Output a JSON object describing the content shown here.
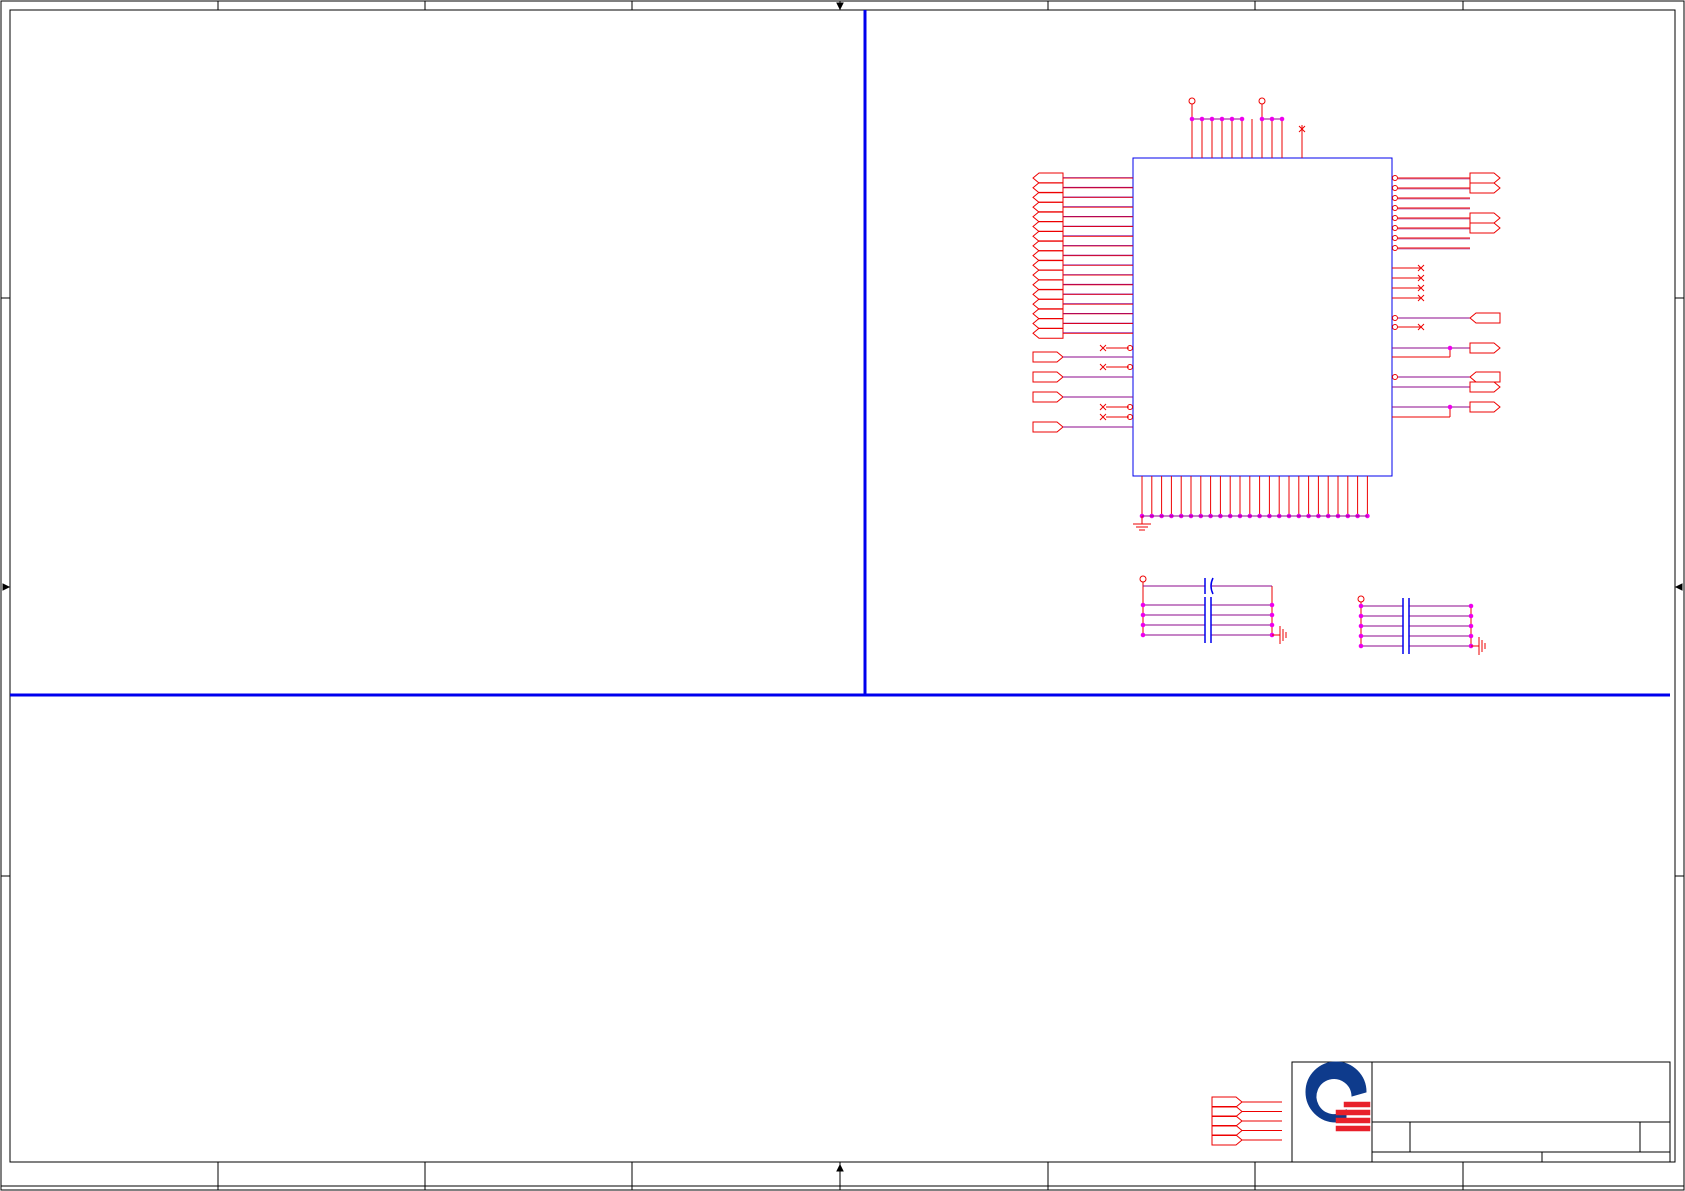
{
  "colors": {
    "frame": "#000000",
    "divider": "#0000ee",
    "chip_outline": "#0000ee",
    "wire": "#ee0000",
    "net_wire": "#8e0a8e",
    "junction": "#ee00ee",
    "logo_blue": "#0e3b8c",
    "logo_red": "#e8202a"
  },
  "diagram": {
    "top_power_pins": 12,
    "left_port_count": 17,
    "left_input_ports": 4,
    "right_signal_pins": 8,
    "right_nc_pins": 4,
    "bottom_ground_pins": 24,
    "decoupling_groups": 2,
    "title_block_ports": 5,
    "icons": [
      "company-logo-icon",
      "ground-symbol-icon",
      "capacitor-icon",
      "power-flag-icon",
      "no-connect-icon"
    ]
  }
}
